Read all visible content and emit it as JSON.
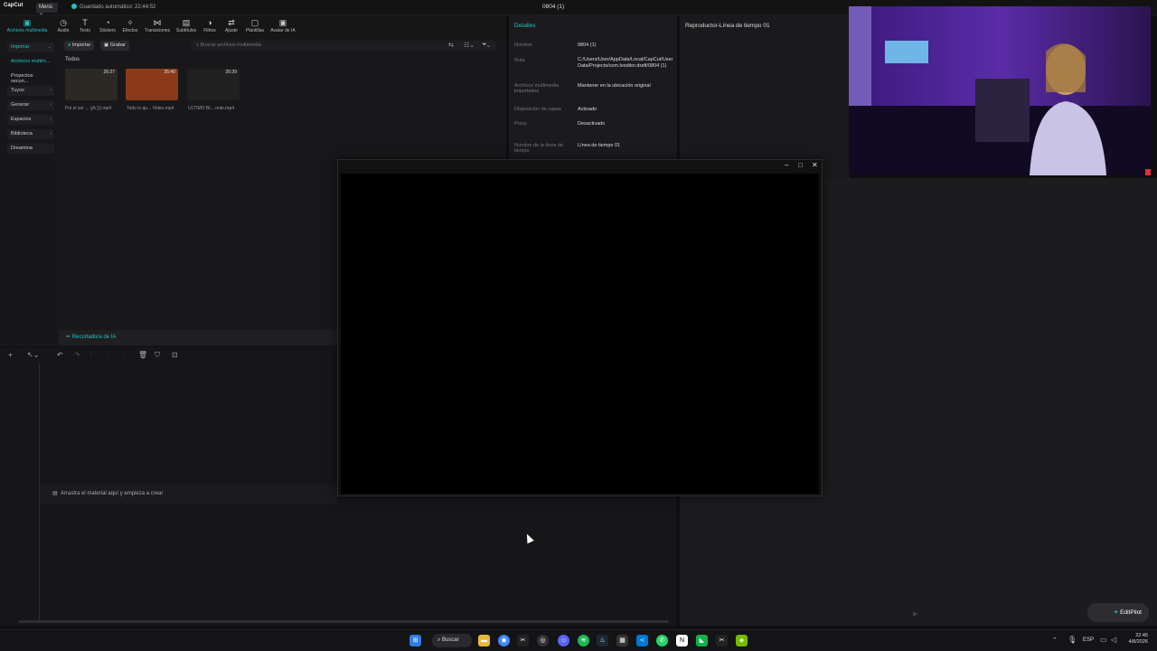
{
  "app": {
    "name": "CapCut",
    "menu_label": "Menú ⌄",
    "autosave": "Guardado automático: 22:44:52",
    "project_title": "0804 (1)"
  },
  "toolbar": {
    "items": [
      {
        "label": "Archivos multimedia",
        "icon": "media-icon"
      },
      {
        "label": "Audio",
        "icon": "audio-icon"
      },
      {
        "label": "Texto",
        "icon": "text-icon"
      },
      {
        "label": "Stickers",
        "icon": "sticker-icon"
      },
      {
        "label": "Efectos",
        "icon": "effects-icon"
      },
      {
        "label": "Transiciones",
        "icon": "transitions-icon"
      },
      {
        "label": "Subtítulos",
        "icon": "subtitles-icon"
      },
      {
        "label": "Filtros",
        "icon": "filters-icon"
      },
      {
        "label": "Ajuste",
        "icon": "adjust-icon"
      },
      {
        "label": "Plantillas",
        "icon": "templates-icon"
      },
      {
        "label": "Avatar de IA",
        "icon": "avatar-icon"
      }
    ]
  },
  "leftnav": {
    "items": [
      {
        "label": "Importar"
      },
      {
        "label": "Archivos multim..."
      },
      {
        "label": "Proyectos secun..."
      },
      {
        "label": "Tuyos"
      },
      {
        "label": "Generar"
      },
      {
        "label": "Espacios"
      },
      {
        "label": "Biblioteca"
      },
      {
        "label": "Dreamina"
      }
    ]
  },
  "media": {
    "import_label": "Importar",
    "record_label": "Grabar",
    "search_placeholder": "Buscar archivos multimedia",
    "section_label": "Todos",
    "thumbs": [
      {
        "duration": "26:27",
        "name": "Pol el ser ... (jA ))).mp4",
        "color": "#2c2924"
      },
      {
        "duration": "35:40",
        "name": "Todo lo qu... Video.mp4",
        "color": "#8a3a18"
      },
      {
        "duration": "26:39",
        "name": "ULTIMO BL...onte.mp4",
        "color": "#202020"
      }
    ],
    "ai_cropper_label": "Recortadora de IA"
  },
  "details": {
    "header": "Detalles",
    "rows": [
      {
        "k": "Nombre",
        "v": "0804 (1)"
      },
      {
        "k": "Ruta",
        "v": "C:/Users/User/AppData/Local/CapCut/User Data/Projects/com.lveditor.draft/0804 (1)"
      },
      {
        "k": "Archivos multimedia importados",
        "v": "Mantener en la ubicación original"
      },
      {
        "k": "Disposición de capas",
        "v": "Activado"
      },
      {
        "k": "Proxy",
        "v": "Desactivado"
      },
      {
        "k": "Nombre de la línea de tiempo",
        "v": "Línea de tiempo 01"
      }
    ]
  },
  "player": {
    "header": "Reproductor-Línea de tiempo 01"
  },
  "timeline": {
    "drop_hint": "Arrastra el material aquí y empieza a crear"
  },
  "editpilot": {
    "label": "EditPilot"
  },
  "taskbar": {
    "search_label": "Buscar",
    "lang": "ESP",
    "time": "22:45",
    "date": "4/8/2026"
  }
}
